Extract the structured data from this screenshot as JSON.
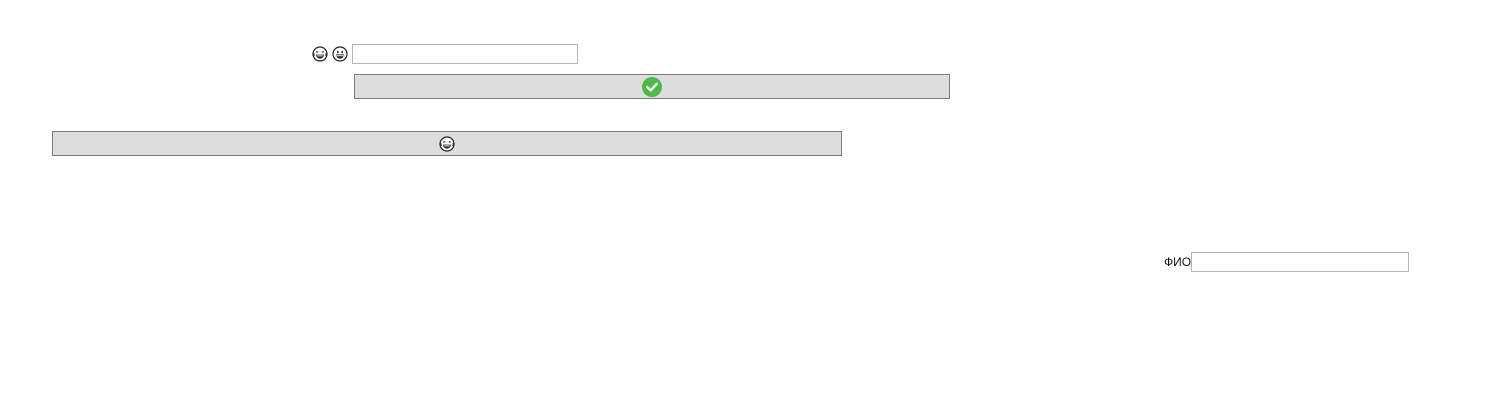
{
  "top_row": {
    "icons": [
      "laughing-emoji-icon",
      "grinning-emoji-icon"
    ],
    "input_value": "",
    "input_placeholder": ""
  },
  "confirm_button": {
    "icon": "checkmark-icon",
    "icon_color": "#4cba48"
  },
  "emoji_button": {
    "icon": "laughing-emoji-icon"
  },
  "fio_field": {
    "label": "ФИО",
    "input_value": "",
    "input_placeholder": ""
  },
  "colors": {
    "button_background": "#dddddd",
    "button_border": "#7a7a7a",
    "input_border": "#b5b5b5",
    "check_green": "#4cba48"
  }
}
